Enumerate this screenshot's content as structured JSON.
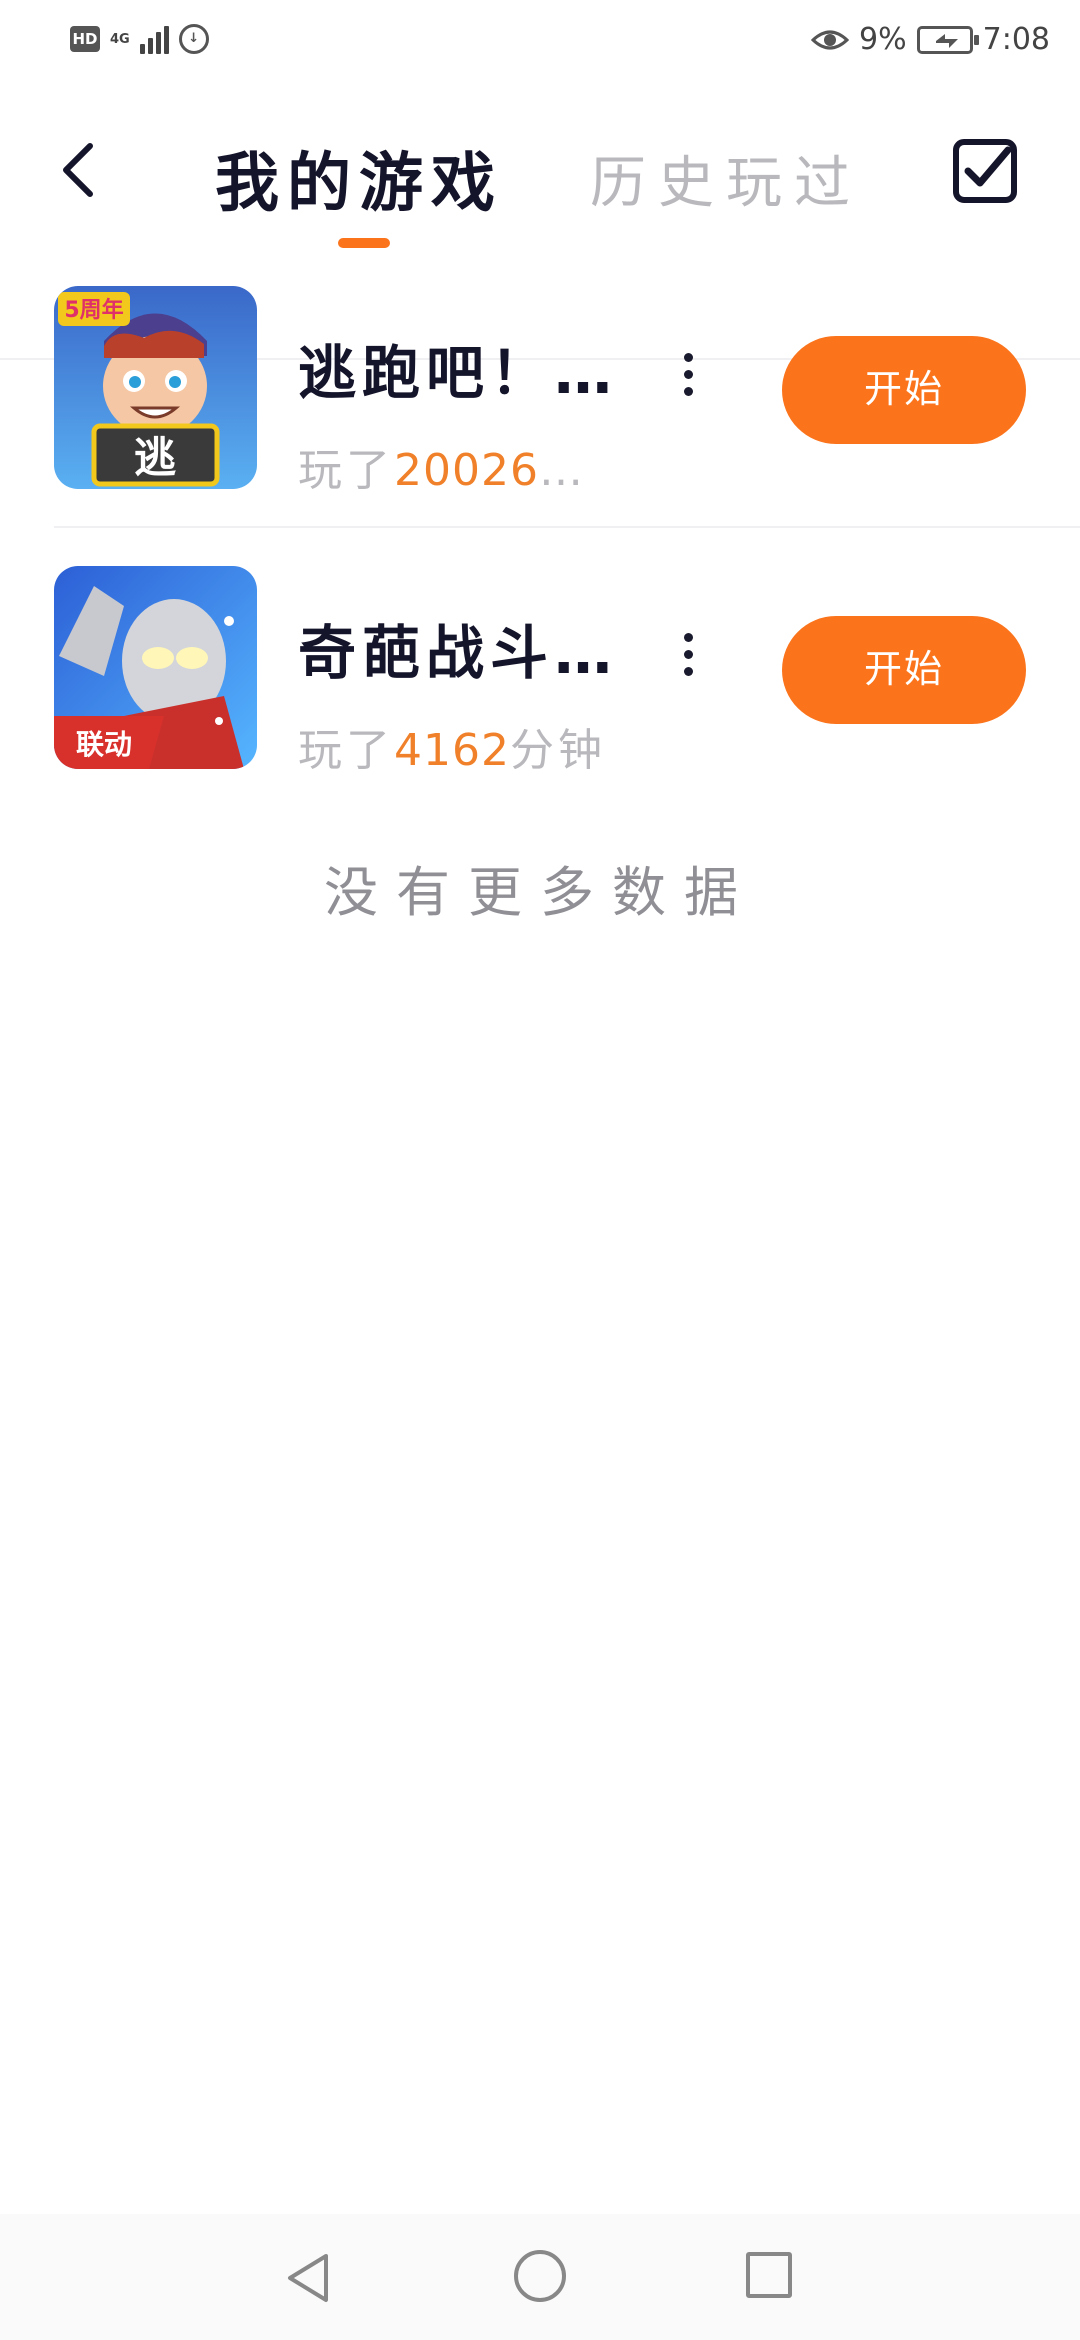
{
  "status_bar": {
    "hd_label": "HD",
    "network_label": "4G",
    "battery_percent": "9%",
    "time": "7:08"
  },
  "header": {
    "tab_mine": "我的游戏",
    "tab_history": "历史玩过",
    "active_tab": "tab_mine"
  },
  "games": [
    {
      "title": "逃跑吧！…",
      "played_prefix": "玩了",
      "played_value": "20026",
      "played_suffix": "…",
      "start_label": "开始",
      "icon_badge_top": "5周年",
      "icon_badge_center": "逃"
    },
    {
      "title": "奇葩战斗…",
      "played_prefix": "玩了",
      "played_value": "4162",
      "played_suffix": "分钟",
      "start_label": "开始",
      "icon_badge_bottom": "联动"
    }
  ],
  "footer_text": "没有更多数据",
  "colors": {
    "accent": "#fb741c",
    "title": "#14142b",
    "muted": "#b9b9bd",
    "played_number": "#f0812a"
  },
  "icons": {
    "back": "chevron-left-icon",
    "select": "checkbox-checked-icon",
    "more": "more-vertical-icon",
    "nav_back": "triangle-back-icon",
    "nav_home": "circle-home-icon",
    "nav_recent": "square-recent-icon"
  }
}
